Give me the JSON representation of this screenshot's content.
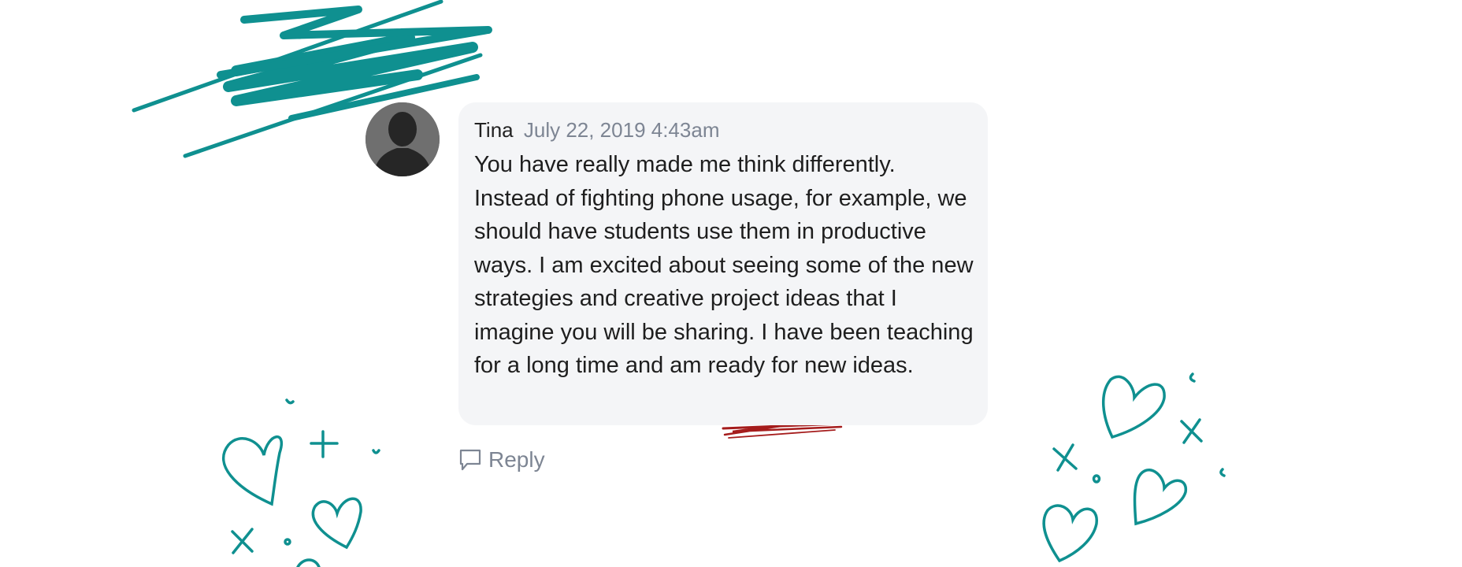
{
  "comment": {
    "author": "Tina",
    "timestamp": "July 22, 2019 4:43am",
    "message": "You have really made me think differently. Instead of fighting phone usage, for example, we should have students use them in productive ways. I am excited about seeing some of the new strategies and creative project ideas that I imagine you will be sharing. I have been teaching for a long time and am ready for new ideas."
  },
  "actions": {
    "reply_label": "Reply"
  },
  "icons": {
    "avatar": "user-silhouette-icon",
    "reply": "speech-bubble-icon"
  },
  "colors": {
    "bubble_background": "#f4f5f7",
    "timestamp": "#7d8593",
    "doodle_teal": "#0f9090",
    "annotation_red": "#a51c1c"
  }
}
